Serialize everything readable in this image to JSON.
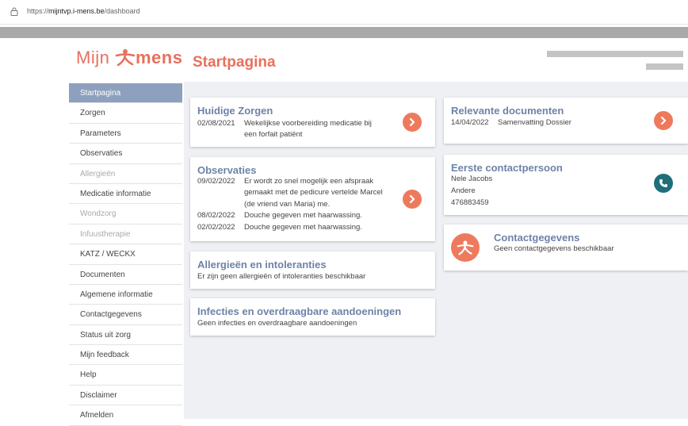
{
  "browser": {
    "url_prefix": "https://",
    "url_host": "mijntvp.i-mens.be",
    "url_path": "/dashboard"
  },
  "header": {
    "logo_mijn": "Mijn",
    "logo_mens": "mens",
    "page_title": "Startpagina"
  },
  "sidebar": {
    "items": [
      {
        "label": "Startpagina",
        "state": "active"
      },
      {
        "label": "Zorgen",
        "state": "normal"
      },
      {
        "label": "Parameters",
        "state": "normal"
      },
      {
        "label": "Observaties",
        "state": "normal"
      },
      {
        "label": "Allergieën",
        "state": "disabled"
      },
      {
        "label": "Medicatie informatie",
        "state": "normal"
      },
      {
        "label": "Wondzorg",
        "state": "disabled"
      },
      {
        "label": "Infuustherapie",
        "state": "disabled"
      },
      {
        "label": "KATZ / WECKX",
        "state": "normal"
      },
      {
        "label": "Documenten",
        "state": "normal"
      },
      {
        "label": "Algemene informatie",
        "state": "normal"
      },
      {
        "label": "Contactgegevens",
        "state": "normal"
      },
      {
        "label": "Status uit zorg",
        "state": "normal"
      },
      {
        "label": "Mijn feedback",
        "state": "normal"
      },
      {
        "label": "Help",
        "state": "normal"
      },
      {
        "label": "Disclaimer",
        "state": "normal"
      },
      {
        "label": "Afmelden",
        "state": "normal"
      }
    ]
  },
  "cards": {
    "zorgen": {
      "title": "Huidige Zorgen",
      "date": "02/08/2021",
      "text_line1": "Wekelijkse voorbereiding medicatie bij",
      "text_line2": "een forfait patiënt"
    },
    "observaties": {
      "title": "Observaties",
      "entry1_date": "09/02/2022",
      "entry1_line1": "Er wordt zo snel mogelijk een afspraak",
      "entry1_line2": "gemaakt met de pedicure vertelde Marcel",
      "entry1_line3": "(de vriend van Maria) me.",
      "entry2_date": "08/02/2022",
      "entry2_text": "Douche gegeven met haarwassing.",
      "entry3_date": "02/02/2022",
      "entry3_text": "Douche gegeven met haarwassing."
    },
    "allergieen": {
      "title": "Allergieën en intoleranties",
      "text": "Er zijn geen allergieën of intoleranties beschikbaar"
    },
    "infecties": {
      "title": "Infecties en overdraagbare aandoeningen",
      "text": "Geen infecties en overdraagbare aandoeningen"
    },
    "documenten": {
      "title": "Relevante documenten",
      "date": "14/04/2022",
      "text": "Samenvatting Dossier"
    },
    "contactpersoon": {
      "title": "Eerste contactpersoon",
      "name": "Nele Jacobs",
      "relation": "Andere",
      "phone": "476883459"
    },
    "contactgegevens": {
      "title": "Contactgegevens",
      "text": "Geen contactgegevens beschikbaar"
    }
  },
  "colors": {
    "accent": "#ee7a5e",
    "title_blue": "#6e83a8",
    "sidebar_active": "#8da0bd",
    "phone": "#1f6e7a"
  }
}
